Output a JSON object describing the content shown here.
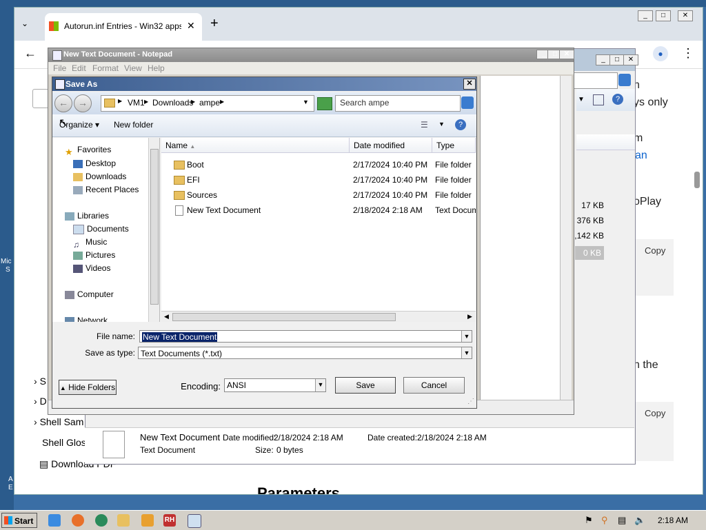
{
  "browser": {
    "tab_title": "Autorun.inf Entries - Win32 apps",
    "new_tab": "+",
    "page": {
      "right_text_1": "n",
      "right_text_2": "ys only",
      "right_text_3": "m",
      "right_text_4": "an",
      "right_text_5": "oPlay",
      "right_text_6": "n the",
      "copy_label": "Copy",
      "toc_items": [
        "Shell Sam",
        "Shell Glos"
      ],
      "toc_letters": [
        "S",
        "D"
      ],
      "download_pdf": "Download PDF",
      "heading": "Parameters"
    },
    "left_labels": [
      "Mic",
      "S",
      "A",
      "E"
    ]
  },
  "explorer": {
    "sizes": [
      "17 KB",
      "376 KB",
      ",142 KB",
      "0 KB"
    ],
    "details": {
      "name": "New Text Document",
      "modified_label": "Date modified:",
      "modified": "2/18/2024 2:18 AM",
      "created_label": "Date created:",
      "created": "2/18/2024 2:18 AM",
      "type": "Text Document",
      "size_label": "Size:",
      "size": "0 bytes"
    }
  },
  "notepad": {
    "title": "New Text Document - Notepad",
    "menu": [
      "File",
      "Edit",
      "Format",
      "View",
      "Help"
    ]
  },
  "dialog": {
    "title": "Save As",
    "breadcrumb": [
      "VM1",
      "Downloads",
      "ampe"
    ],
    "search_placeholder": "Search ampe",
    "organize": "Organize",
    "new_folder": "New folder",
    "nav": {
      "favorites": "Favorites",
      "desktop": "Desktop",
      "downloads": "Downloads",
      "recent": "Recent Places",
      "libraries": "Libraries",
      "documents": "Documents",
      "music": "Music",
      "pictures": "Pictures",
      "videos": "Videos",
      "computer": "Computer",
      "network": "Network"
    },
    "columns": {
      "name": "Name",
      "date": "Date modified",
      "type": "Type"
    },
    "files": [
      {
        "name": "Boot",
        "date": "2/17/2024 10:40 PM",
        "type": "File folder",
        "icon": "folder-icon"
      },
      {
        "name": "EFI",
        "date": "2/17/2024 10:40 PM",
        "type": "File folder",
        "icon": "folder-icon"
      },
      {
        "name": "Sources",
        "date": "2/17/2024 10:40 PM",
        "type": "File folder",
        "icon": "folder-icon"
      },
      {
        "name": "New Text Document",
        "date": "2/18/2024 2:18 AM",
        "type": "Text Document",
        "icon": "text-file-icon"
      }
    ],
    "file_name_label": "File name:",
    "file_name_value": "New Text Document",
    "save_type_label": "Save as type:",
    "save_type_value": "Text Documents (*.txt)",
    "hide_folders": "Hide Folders",
    "encoding_label": "Encoding:",
    "encoding_value": "ANSI",
    "save": "Save",
    "cancel": "Cancel"
  },
  "taskbar": {
    "start": "Start",
    "clock": "2:18 AM",
    "pinned_label": "RH"
  }
}
